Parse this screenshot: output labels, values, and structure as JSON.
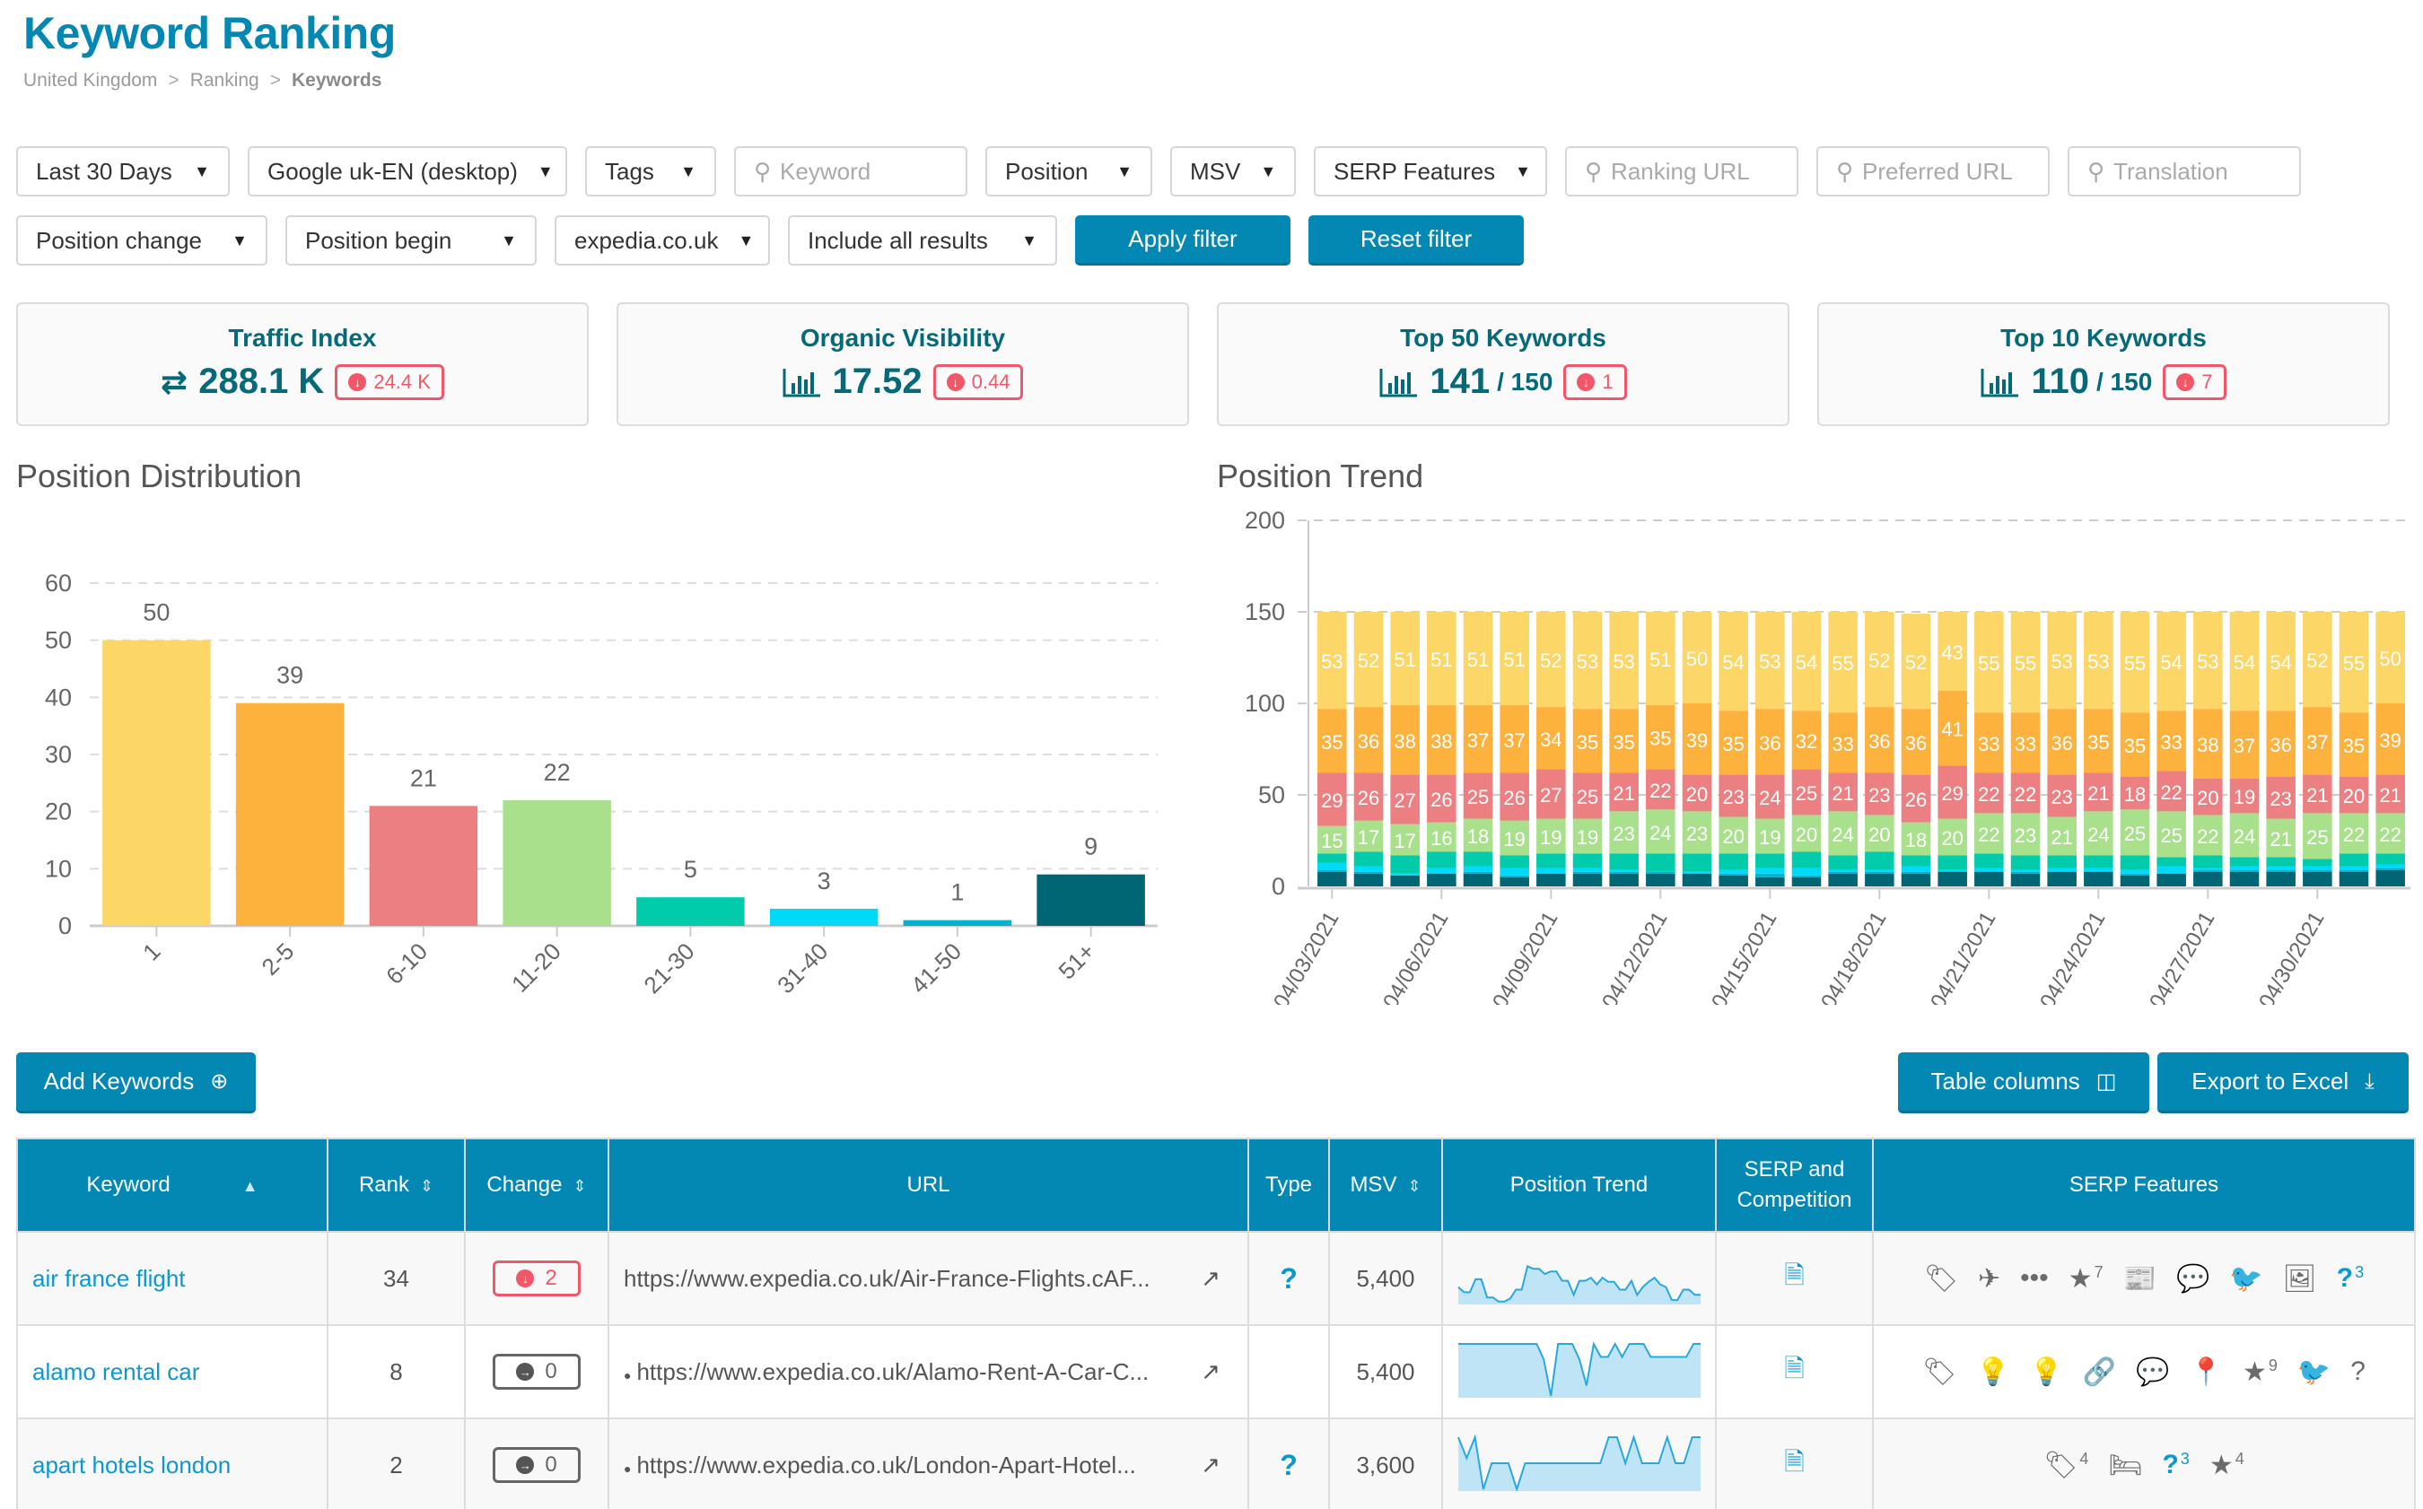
{
  "header": {
    "title": "Keyword Ranking",
    "breadcrumb": [
      "United Kingdom",
      "Ranking",
      "Keywords"
    ],
    "breadcrumb_sep": ">"
  },
  "filters": {
    "row1": [
      {
        "type": "select",
        "label": "Last 30 Days"
      },
      {
        "type": "select",
        "label": "Google uk-EN (desktop)"
      },
      {
        "type": "select",
        "label": "Tags"
      },
      {
        "type": "search",
        "placeholder": "Keyword",
        "value": ""
      },
      {
        "type": "select",
        "label": "Position"
      },
      {
        "type": "select",
        "label": "MSV"
      },
      {
        "type": "select",
        "label": "SERP Features"
      },
      {
        "type": "search",
        "placeholder": "Ranking URL",
        "value": ""
      },
      {
        "type": "search",
        "placeholder": "Preferred URL",
        "value": ""
      },
      {
        "type": "search",
        "placeholder": "Translation",
        "value": ""
      }
    ],
    "row2": [
      {
        "type": "select",
        "label": "Position change"
      },
      {
        "type": "select",
        "label": "Position begin"
      },
      {
        "type": "select",
        "label": "expedia.co.uk"
      },
      {
        "type": "select",
        "label": "Include all results"
      }
    ],
    "apply_label": "Apply filter",
    "reset_label": "Reset filter",
    "caret": "▼",
    "search_icon": "search-icon"
  },
  "kpis": [
    {
      "title": "Traffic Index",
      "icon": "⇄",
      "icon_name": "transfer-icon",
      "value": "288.1 K",
      "of": "",
      "delta": "24.4 K",
      "delta_dir": "down"
    },
    {
      "title": "Organic Visibility",
      "icon": "📊",
      "icon_name": "bar-chart-icon",
      "value": "17.52",
      "of": "",
      "delta": "0.44",
      "delta_dir": "down"
    },
    {
      "title": "Top 50 Keywords",
      "icon": "📊",
      "icon_name": "bar-chart-icon",
      "value": "141",
      "of": "/ 150",
      "delta": "1",
      "delta_dir": "down"
    },
    {
      "title": "Top 10 Keywords",
      "icon": "📊",
      "icon_name": "bar-chart-icon",
      "value": "110",
      "of": "/ 150",
      "delta": "7",
      "delta_dir": "down"
    }
  ],
  "colors": {
    "accent": "#0288b3",
    "kpi_text": "#046a78",
    "negative": "#f0586a",
    "link": "#0b98cf",
    "series": [
      "#fdd668",
      "#fdb23e",
      "#ec7f82",
      "#a8e08c",
      "#00cbaa",
      "#00d9f7",
      "#00b2cf",
      "#006674"
    ]
  },
  "chart_data": [
    {
      "type": "bar",
      "title": "Position Distribution",
      "categories": [
        "1",
        "2-5",
        "6-10",
        "11-20",
        "21-30",
        "31-40",
        "41-50",
        "51+"
      ],
      "values": [
        50,
        39,
        21,
        22,
        5,
        3,
        1,
        9
      ],
      "xlabel": "",
      "ylabel": "",
      "ylim": [
        0,
        60
      ],
      "yticks": [
        0,
        10,
        20,
        30,
        40,
        50,
        60
      ],
      "grid": true,
      "data_labels": true
    },
    {
      "type": "bar",
      "stacked": true,
      "title": "Position Trend",
      "x": [
        "04/03/2021",
        "04/04/2021",
        "04/05/2021",
        "04/06/2021",
        "04/07/2021",
        "04/08/2021",
        "04/09/2021",
        "04/10/2021",
        "04/11/2021",
        "04/12/2021",
        "04/13/2021",
        "04/14/2021",
        "04/15/2021",
        "04/16/2021",
        "04/17/2021",
        "04/18/2021",
        "04/19/2021",
        "04/20/2021",
        "04/21/2021",
        "04/22/2021",
        "04/23/2021",
        "04/24/2021",
        "04/25/2021",
        "04/26/2021",
        "04/27/2021",
        "04/28/2021",
        "04/29/2021",
        "04/30/2021",
        "05/01/2021",
        "05/02/2021"
      ],
      "xtick_labels": [
        "04/03/2021",
        "04/06/2021",
        "04/09/2021",
        "04/12/2021",
        "04/15/2021",
        "04/18/2021",
        "04/21/2021",
        "04/24/2021",
        "04/27/2021",
        "04/30/2021"
      ],
      "ylim": [
        0,
        200
      ],
      "yticks": [
        0,
        50,
        100,
        150,
        200
      ],
      "grid": true,
      "series": [
        {
          "name": "51+",
          "values": [
            8,
            7,
            6,
            7,
            7,
            5,
            7,
            7,
            7,
            7,
            7,
            6,
            5,
            5,
            7,
            7,
            7,
            8,
            8,
            7,
            8,
            8,
            6,
            7,
            8,
            8,
            8,
            8,
            8,
            9
          ],
          "labeled": false
        },
        {
          "name": "41-50",
          "values": [
            1,
            1,
            0,
            0,
            1,
            1,
            0,
            1,
            1,
            1,
            0,
            1,
            2,
            1,
            1,
            1,
            1,
            0,
            0,
            1,
            0,
            0,
            1,
            0,
            1,
            1,
            1,
            1,
            1,
            1
          ],
          "labeled": false
        },
        {
          "name": "31-40",
          "values": [
            4,
            3,
            1,
            3,
            3,
            4,
            3,
            2,
            1,
            0,
            1,
            2,
            3,
            4,
            1,
            1,
            3,
            1,
            2,
            1,
            2,
            2,
            2,
            4,
            1,
            2,
            2,
            2,
            2,
            2
          ],
          "labeled": false
        },
        {
          "name": "21-30",
          "values": [
            5,
            8,
            10,
            9,
            8,
            7,
            8,
            8,
            9,
            10,
            10,
            9,
            8,
            9,
            8,
            10,
            6,
            8,
            8,
            8,
            7,
            7,
            8,
            5,
            7,
            5,
            5,
            4,
            7,
            6
          ],
          "labeled": false
        },
        {
          "name": "11-20",
          "values": [
            15,
            17,
            17,
            16,
            18,
            19,
            19,
            19,
            23,
            24,
            23,
            20,
            19,
            20,
            24,
            20,
            18,
            20,
            22,
            23,
            21,
            24,
            25,
            25,
            22,
            24,
            21,
            25,
            22,
            22
          ],
          "labeled": true
        },
        {
          "name": "6-10",
          "values": [
            29,
            26,
            27,
            26,
            25,
            26,
            27,
            25,
            21,
            22,
            20,
            23,
            24,
            25,
            21,
            23,
            26,
            29,
            22,
            22,
            23,
            21,
            18,
            22,
            20,
            19,
            23,
            21,
            20,
            21
          ],
          "labeled": true
        },
        {
          "name": "2-5",
          "values": [
            35,
            36,
            38,
            38,
            37,
            37,
            34,
            35,
            35,
            35,
            39,
            35,
            36,
            32,
            33,
            36,
            36,
            41,
            33,
            33,
            36,
            35,
            35,
            33,
            38,
            37,
            36,
            37,
            35,
            39
          ],
          "labeled": true
        },
        {
          "name": "1",
          "values": [
            53,
            52,
            51,
            51,
            51,
            51,
            52,
            53,
            53,
            51,
            50,
            54,
            53,
            54,
            55,
            52,
            52,
            43,
            55,
            55,
            53,
            53,
            55,
            54,
            53,
            54,
            54,
            52,
            55,
            50
          ],
          "labeled": true
        }
      ]
    }
  ],
  "actions": {
    "add_keywords": "Add Keywords",
    "add_icon": "⊕",
    "table_columns": "Table columns",
    "columns_icon": "◫",
    "export": "Export to Excel",
    "export_icon": "⤓"
  },
  "table": {
    "columns": [
      {
        "label": "Keyword",
        "sort": "▲"
      },
      {
        "label": "Rank",
        "sort": "⇕"
      },
      {
        "label": "Change",
        "sort": "⇕"
      },
      {
        "label": "URL",
        "sort": ""
      },
      {
        "label": "Type",
        "sort": ""
      },
      {
        "label": "MSV",
        "sort": "⇕"
      },
      {
        "label": "Position Trend",
        "sort": ""
      },
      {
        "label": "SERP and Competition",
        "sort": ""
      },
      {
        "label": "SERP Features",
        "sort": ""
      }
    ],
    "rows": [
      {
        "keyword": "air france flight",
        "rank": "34",
        "change": "2",
        "change_dir": "down",
        "url": "https://www.expedia.co.uk/Air-France-Flights.cAF...",
        "url_bullet": false,
        "type": "?",
        "msv": "5,400",
        "trend": [
          30,
          20,
          20,
          45,
          45,
          10,
          10,
          2,
          2,
          8,
          25,
          25,
          70,
          65,
          65,
          55,
          60,
          60,
          42,
          42,
          15,
          42,
          42,
          48,
          35,
          48,
          40,
          40,
          25,
          25,
          42,
          15,
          30,
          40,
          48,
          35,
          30,
          5,
          5,
          25,
          25,
          15,
          15
        ],
        "features": [
          {
            "icon": "tags-icon",
            "glyph": "🏷",
            "count": ""
          },
          {
            "icon": "plane-icon",
            "glyph": "✈",
            "count": ""
          },
          {
            "icon": "ellipsis-icon",
            "glyph": "•••",
            "count": ""
          },
          {
            "icon": "star-icon",
            "glyph": "★",
            "count": "7"
          },
          {
            "icon": "newspaper-icon",
            "glyph": "📰",
            "count": ""
          },
          {
            "icon": "comments-icon",
            "glyph": "💬",
            "count": ""
          },
          {
            "icon": "twitter-icon",
            "glyph": "🐦",
            "count": ""
          },
          {
            "icon": "image-icon",
            "glyph": "🖼",
            "count": ""
          },
          {
            "icon": "question-icon",
            "glyph": "?",
            "count": "3",
            "highlight": true
          }
        ]
      },
      {
        "keyword": "alamo rental car",
        "rank": "8",
        "change": "0",
        "change_dir": "same",
        "url": "https://www.expedia.co.uk/Alamo-Rent-A-Car-C...",
        "url_bullet": true,
        "type": "",
        "msv": "5,400",
        "trend": [
          100,
          100,
          100,
          100,
          100,
          100,
          100,
          100,
          100,
          100,
          100,
          100,
          70,
          0,
          100,
          100,
          100,
          70,
          20,
          100,
          75,
          75,
          100,
          75,
          100,
          100,
          100,
          75,
          75,
          75,
          75,
          75,
          75,
          100,
          100
        ],
        "features": [
          {
            "icon": "tags-icon",
            "glyph": "🏷",
            "count": ""
          },
          {
            "icon": "lightbulb-icon",
            "glyph": "💡",
            "count": ""
          },
          {
            "icon": "lightbulb-icon",
            "glyph": "💡",
            "count": ""
          },
          {
            "icon": "link-icon",
            "glyph": "🔗",
            "count": ""
          },
          {
            "icon": "comments-icon",
            "glyph": "💬",
            "count": ""
          },
          {
            "icon": "map-marker-icon",
            "glyph": "📍",
            "count": ""
          },
          {
            "icon": "star-icon",
            "glyph": "★",
            "count": "9"
          },
          {
            "icon": "twitter-icon",
            "glyph": "🐦",
            "count": ""
          },
          {
            "icon": "question-icon",
            "glyph": "?",
            "count": ""
          }
        ]
      },
      {
        "keyword": "apart hotels london",
        "rank": "2",
        "change": "0",
        "change_dir": "same",
        "url": "https://www.expedia.co.uk/London-Apart-Hotel...",
        "url_bullet": true,
        "type": "?",
        "msv": "3,600",
        "trend": [
          100,
          60,
          100,
          0,
          50,
          50,
          50,
          0,
          50,
          50,
          50,
          50,
          50,
          50,
          50,
          50,
          50,
          50,
          100,
          100,
          50,
          100,
          50,
          50,
          50,
          100,
          50,
          50,
          100,
          100
        ],
        "features": [
          {
            "icon": "tags-icon",
            "glyph": "🏷",
            "count": "4"
          },
          {
            "icon": "bed-icon",
            "glyph": "🛏",
            "count": ""
          },
          {
            "icon": "question-icon",
            "glyph": "?",
            "count": "3",
            "highlight": true
          },
          {
            "icon": "star-icon",
            "glyph": "★",
            "count": "4"
          }
        ]
      }
    ]
  }
}
